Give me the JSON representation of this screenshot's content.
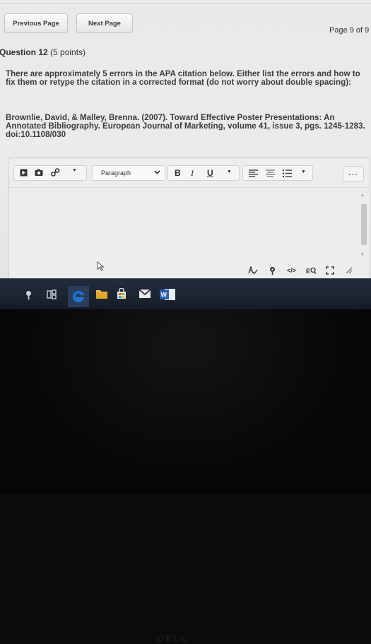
{
  "nav": {
    "prev_label": "Previous Page",
    "next_label": "Next Page",
    "page_indicator": "Page 9 of 9"
  },
  "question": {
    "title": "Question 12",
    "points": "(5 points)",
    "text": "There are approximately 5 errors in the APA citation below. Either list the errors and how to fix them or retype the citation in a corrected format (do not worry about double spacing):",
    "citation_line1": "Brownlie, David, & Malley, Brenna. (2007). Toward Effective Poster Presentations: An",
    "citation_line2": "Annotated Bibliography. European Journal of Marketing, volume 41, issue 3, pgs. 1245-1283.",
    "citation_line3": "doi:10.1108/030"
  },
  "editor": {
    "paragraph_select": "Paragraph",
    "bold_label": "B",
    "italic_label": "I",
    "underline_label": "U",
    "more_label": "...",
    "answer_text": "",
    "toolbar_icons": [
      "insert-media-icon",
      "insert-image-icon",
      "insert-link-icon",
      "dropdown-chevron-icon",
      "align-left-icon",
      "align-center-icon",
      "list-icon",
      "list-dropdown-icon"
    ],
    "bottom_icons": [
      "spellcheck-icon",
      "accessibility-icon",
      "html-source-icon",
      "find-replace-icon",
      "fullscreen-icon",
      "resize-handle-icon"
    ]
  },
  "taskbar": {
    "apps": [
      "search-icon",
      "task-view-icon",
      "edge-browser-icon",
      "file-explorer-icon",
      "store-icon",
      "mail-icon",
      "word-icon"
    ]
  },
  "colors": {
    "page_bg": "#ebebea",
    "taskbar_bg": "#1c2431",
    "edge_blue": "#1e73d6",
    "word_blue": "#2b5fb0"
  }
}
